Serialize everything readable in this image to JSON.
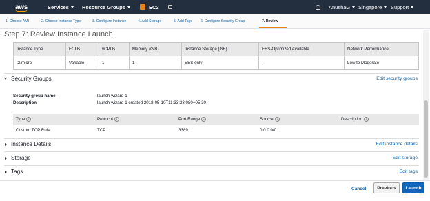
{
  "nav": {
    "logo": "aws",
    "services": "Services",
    "resource_groups": "Resource Groups",
    "service": "EC2",
    "user": "AnushaG",
    "region": "Singapore",
    "support": "Support"
  },
  "steps": [
    {
      "label": "1. Choose AMI"
    },
    {
      "label": "2. Choose Instance Type"
    },
    {
      "label": "3. Configure Instance"
    },
    {
      "label": "4. Add Storage"
    },
    {
      "label": "5. Add Tags"
    },
    {
      "label": "6. Configure Security Group"
    },
    {
      "label": "7. Review"
    }
  ],
  "page_title": "Step 7: Review Instance Launch",
  "instance_table": {
    "headers": [
      "Instance Type",
      "ECUs",
      "vCPUs",
      "Memory (GiB)",
      "Instance Storage (GB)",
      "EBS-Optimized Available",
      "Network Performance"
    ],
    "row": [
      "t2.micro",
      "Variable",
      "1",
      "1",
      "EBS only",
      "-",
      "Low to Moderate"
    ]
  },
  "security_groups": {
    "title": "Security Groups",
    "edit": "Edit security groups",
    "name_label": "Security group name",
    "name_value": "launch-wizard-1",
    "desc_label": "Description",
    "desc_value": "launch-wizard-1 created 2018-05-10T11:33:23.080+05:30",
    "headers": [
      "Type",
      "Protocol",
      "Port Range",
      "Source",
      "Description"
    ],
    "row": [
      "Custom TCP Rule",
      "TCP",
      "3389",
      "0.0.0.0/0",
      ""
    ]
  },
  "instance_details": {
    "title": "Instance Details",
    "edit": "Edit instance details"
  },
  "storage": {
    "title": "Storage",
    "edit": "Edit storage"
  },
  "tags": {
    "title": "Tags",
    "edit": "Edit tags"
  },
  "footer": {
    "cancel": "Cancel",
    "previous": "Previous",
    "launch": "Launch"
  },
  "colors": {
    "nav_bg": "#232f3e",
    "accent": "#e8831c",
    "link": "#1468b1",
    "primary": "#1166bb"
  }
}
